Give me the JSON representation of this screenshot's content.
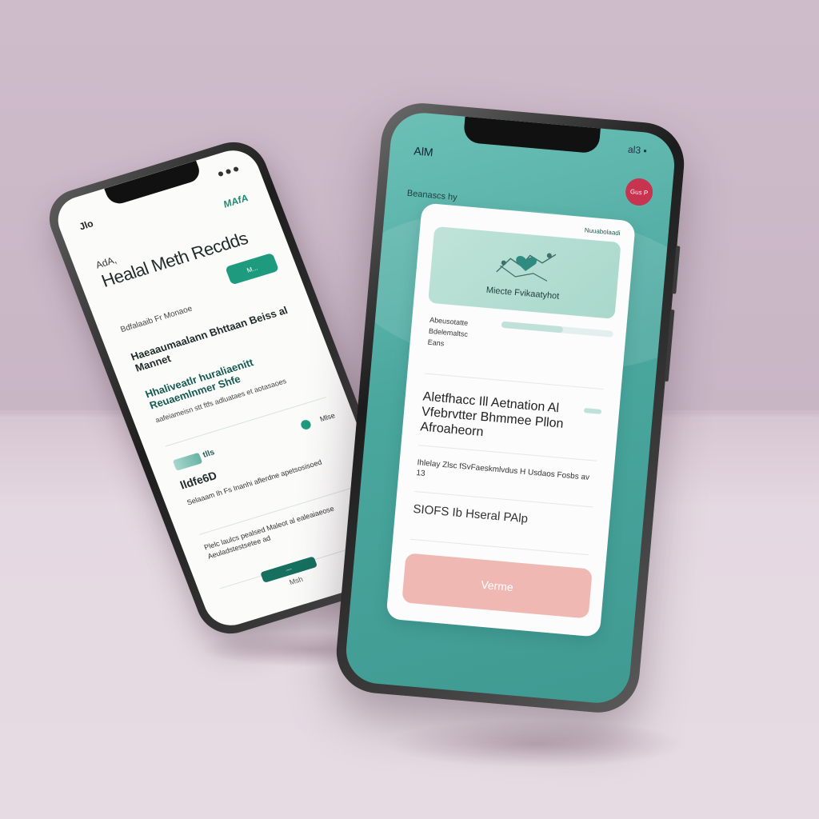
{
  "left_phone": {
    "status": "Jlo",
    "brand": "MAfA",
    "small_label": "AdA,",
    "title": "Healal Meth Recdds",
    "pill": "M...",
    "subtitle": "Bdfalaaib Fr Monaoe",
    "section1": "Haeaaumaalann Bhttaan Beiss al Mannet",
    "section2": "Hhaliveatlr huraliaenitt Reuaemlnmer Shfe",
    "section2_body": "aafeiameisn stt ftfs adluataes et aotasaoes",
    "thumb_label": "tlls",
    "badge_label": "Mlse",
    "hello": "lldfe6D",
    "para1": "Selaaam Ih Fs Inanhi aflerdne apetsosisoed",
    "para2": "Plelc laulcs pealsed Maleot al ealeaiaeose Aeuladstestsetee ad",
    "button": "—",
    "footer": "Msh"
  },
  "right_phone": {
    "status": "AlM",
    "status_icons": "al3 ▪",
    "notification": "Gus P",
    "breadcrumb": "Beanascs hy",
    "card_brand": "Nuuabolaadi",
    "hero_text": "Miecte Fvikaatyhot",
    "progress": 0.55,
    "info_lines": [
      "Abeusotatte",
      "Bdelemaltsc",
      "Eans"
    ],
    "heading": "Aletfhacc Ill Aetnation Al Vfebrvtter Bhmmee Pllon Afroaheorn",
    "body": "Ihlelay Zlsc fSvFaeskmlvdus H Usdaos Fosbs av 13",
    "subheading": "SIOFS Ib Hseral PAlp",
    "button": "Verme"
  },
  "colors": {
    "teal": "#4aa79e",
    "dark_teal": "#15705f",
    "pink_button": "#efb8b3",
    "badge_red": "#c8334f",
    "background": "#cfbccb"
  },
  "icons": [
    "heart-health-icon",
    "signal-icon",
    "battery-icon",
    "notification-badge-icon"
  ]
}
